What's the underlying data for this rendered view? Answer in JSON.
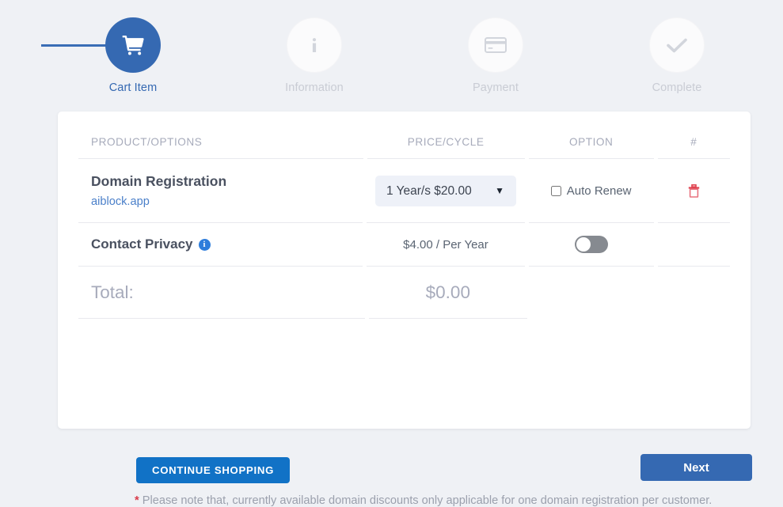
{
  "stepper": {
    "steps": [
      {
        "label": "Cart Item",
        "icon": "shopping-cart-icon",
        "state": "active"
      },
      {
        "label": "Information",
        "icon": "info-icon",
        "state": "inactive"
      },
      {
        "label": "Payment",
        "icon": "credit-card-icon",
        "state": "inactive"
      },
      {
        "label": "Complete",
        "icon": "check-icon",
        "state": "inactive"
      }
    ]
  },
  "cart": {
    "headers": {
      "product": "PRODUCT/OPTIONS",
      "price": "PRICE/CYCLE",
      "option": "OPTION",
      "hash": "#"
    },
    "domain_row": {
      "product_name": "Domain Registration",
      "domain": "aiblock.app",
      "cycle_selected": "1 Year/s $20.00",
      "cycle_options": [
        "1 Year/s $20.00"
      ],
      "auto_renew_label": "Auto Renew",
      "auto_renew_checked": false,
      "delete_icon": "trash-icon"
    },
    "privacy_row": {
      "name": "Contact Privacy",
      "info_icon": "info-circle-icon",
      "info_glyph": "i",
      "price": "$4.00 / Per Year",
      "toggle_on": false
    },
    "total_row": {
      "label": "Total:",
      "value": "$0.00"
    },
    "continue_button": "CONTINUE SHOPPING",
    "note_star": "*",
    "note_text": "Please note that, currently available domain discounts only applicable for one domain registration per customer."
  },
  "footer": {
    "next_button": "Next"
  },
  "colors": {
    "page_background": "#eff1f5",
    "primary_blue": "#3569b2",
    "button_blue": "#1172c6",
    "link_blue": "#4a7fc9",
    "muted_text": "#a7abbb",
    "danger_red": "#d93b4a",
    "toggle_off": "#868a90"
  }
}
